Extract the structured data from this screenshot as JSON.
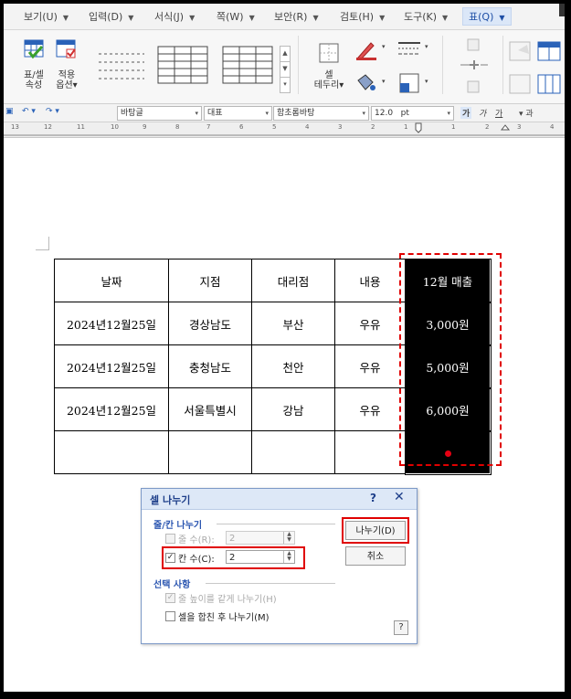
{
  "menubar": {
    "items": [
      "보기(U)",
      "입력(D)",
      "서식(J)",
      "쪽(W)",
      "보안(R)",
      "검토(H)",
      "도구(K)"
    ],
    "active": "표(Q)"
  },
  "ribbon": {
    "table_cell_props": [
      "표/셀",
      "속성"
    ],
    "apply_options": [
      "적용",
      "옵션▾"
    ],
    "cell_border": [
      "셀",
      "테두리▾"
    ]
  },
  "toolbar": {
    "style": "바탕글",
    "para_style": "대표",
    "font": "함초롬바탕",
    "size": "12.0",
    "unit": "pt",
    "char_buttons": [
      "가",
      "가",
      "가",
      "과"
    ]
  },
  "ruler": {
    "labels": [
      "13",
      "12",
      "11",
      "10",
      "9",
      "8",
      "7",
      "6",
      "5",
      "4",
      "3",
      "2",
      "1",
      "1",
      "2",
      "3",
      "4"
    ]
  },
  "table": {
    "headers": [
      "날짜",
      "지점",
      "대리점",
      "내용",
      "12월 매출"
    ],
    "rows": [
      [
        "2024년12월25일",
        "경상남도",
        "부산",
        "우유",
        "3,000원"
      ],
      [
        "2024년12월25일",
        "충청남도",
        "천안",
        "우유",
        "5,000원"
      ],
      [
        "2024년12월25일",
        "서울특별시",
        "강남",
        "우유",
        "6,000원"
      ],
      [
        "",
        "",
        "",
        "",
        ""
      ]
    ]
  },
  "dialog": {
    "title": "셀 나누기",
    "help": "?",
    "close": "✕",
    "group1": "줄/칸 나누기",
    "rows_label": "줄 수(R):",
    "rows_value": "2",
    "cols_label": "칸 수(C):",
    "cols_value": "2",
    "group2": "선택 사항",
    "opt_equal_height": "줄 높이를 같게 나누기(H)",
    "opt_merge_first": "셀을 합친 후 나누기(M)",
    "split_button": "나누기(D)",
    "cancel_button": "취소",
    "help_button": "?"
  },
  "colors": {
    "highlight": "#e00000",
    "selected_cell": "#000000",
    "dialog_title_bg": "#dde8f7"
  }
}
